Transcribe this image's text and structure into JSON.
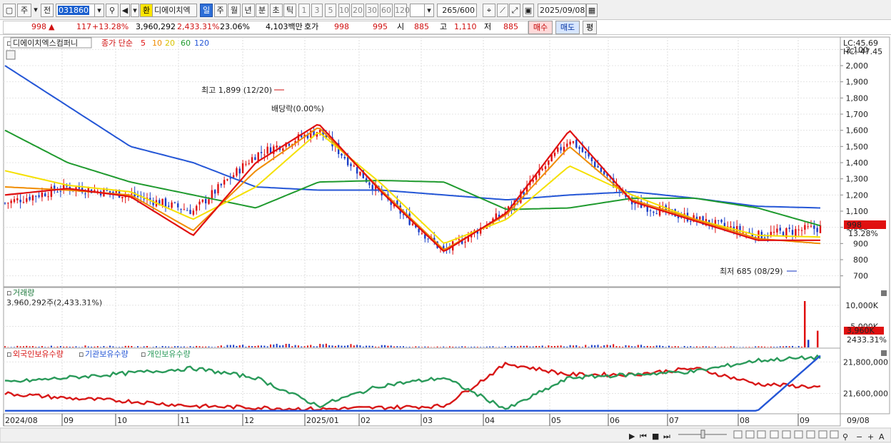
{
  "toolbar": {
    "market_label": "주",
    "prev_label": "전",
    "stock_code": "031860",
    "fx_label": "환",
    "stock_name": "디에이치엑",
    "period_tabs": [
      "일",
      "주",
      "월",
      "년",
      "분",
      "초",
      "틱"
    ],
    "active_period": "일",
    "interval_options": [
      "1",
      "3",
      "5",
      "10",
      "20",
      "30",
      "60",
      "120"
    ],
    "count": "265",
    "count_total": "/600",
    "date": "2025/09/08"
  },
  "quote": {
    "price": "998",
    "change_arrow": "▲",
    "change": "117",
    "change_pct": "+13.28%",
    "volume": "3,960,292",
    "volume_ratio": "2,433.31%",
    "turnover": "23.06%",
    "amount": "4,103백만",
    "ask_label": "호가",
    "ask1": "998",
    "bid1": "995",
    "open_label": "시",
    "open": "885",
    "high_label": "고",
    "high": "1,110",
    "low_label": "저",
    "low": "885",
    "buy_label": "매수",
    "sell_label": "매도",
    "eval_label": "평"
  },
  "price_panel": {
    "stock_name": "디에이치엑스컴퍼니",
    "ma_label": "종가 단순",
    "ma_periods": [
      "5",
      "10",
      "20",
      "60",
      "120"
    ],
    "ma_colors": [
      "#e01010",
      "#f08c00",
      "#f5e000",
      "#1f9a2e",
      "#2456d6"
    ],
    "lc_label": "LC:45.69",
    "hc_label": "HC:-47.45",
    "y_ticks": [
      "2,100",
      "2,000",
      "1,900",
      "1,800",
      "1,700",
      "1,600",
      "1,500",
      "1,400",
      "1,300",
      "1,200",
      "1,100",
      "1,000",
      "900",
      "800",
      "700"
    ],
    "high_annotation": "최고 1,899 (12/20)",
    "low_annotation": "최저 685 (08/29)",
    "dividend_annotation": "배당락(0.00%)",
    "current_price": "998",
    "current_change": "13.28%"
  },
  "volume_panel": {
    "title": "거래량",
    "summary": "3,960,292주(2,433.31%)",
    "y_ticks": [
      "10,000K",
      "5,000K"
    ],
    "current_volume": "3,960K",
    "current_ratio": "2433.31%"
  },
  "holdings_panel": {
    "legend": [
      {
        "name": "외국인보유수량",
        "color": "#d81818"
      },
      {
        "name": "기관보유수량",
        "color": "#2456d6"
      },
      {
        "name": "개인보유수량",
        "color": "#2a9a5a"
      }
    ],
    "y_ticks": [
      "21,800,000",
      "21,600,000"
    ]
  },
  "x_axis": {
    "labels": [
      "2024/08",
      "09",
      "10",
      "11",
      "12",
      "2025/01",
      "02",
      "03",
      "04",
      "05",
      "06",
      "07",
      "08",
      "09"
    ],
    "right_label": "09/08"
  },
  "chart_data": {
    "type": "line",
    "title": "디에이치엑스컴퍼니",
    "x": [
      "2024/08",
      "09",
      "10",
      "11",
      "12",
      "2025/01",
      "02",
      "03",
      "04",
      "05",
      "06",
      "07",
      "08",
      "09"
    ],
    "ylim": [
      650,
      2150
    ],
    "series": [
      {
        "name": "종가",
        "values": [
          1150,
          1250,
          1200,
          1100,
          1450,
          1600,
          1200,
          850,
          1100,
          1550,
          1150,
          1050,
          950,
          998
        ]
      },
      {
        "name": "120",
        "values": [
          2000,
          1750,
          1500,
          1400,
          1250,
          1230,
          1230,
          1200,
          1170,
          1200,
          1220,
          1180,
          1130,
          1120
        ]
      },
      {
        "name": "60",
        "values": [
          1600,
          1400,
          1280,
          1200,
          1120,
          1280,
          1290,
          1280,
          1110,
          1120,
          1180,
          1180,
          1120,
          1010
        ]
      },
      {
        "name": "20",
        "values": [
          1350,
          1260,
          1220,
          1050,
          1250,
          1590,
          1270,
          900,
          1050,
          1380,
          1200,
          1050,
          950,
          940
        ]
      },
      {
        "name": "10",
        "values": [
          1250,
          1230,
          1200,
          980,
          1350,
          1620,
          1230,
          860,
          1080,
          1500,
          1170,
          1050,
          930,
          900
        ]
      },
      {
        "name": "5",
        "values": [
          1200,
          1240,
          1190,
          950,
          1400,
          1640,
          1220,
          850,
          1090,
          1600,
          1160,
          1040,
          920,
          920
        ]
      }
    ],
    "volume": {
      "ylim": [
        0,
        11000
      ],
      "values_k": [
        200,
        300,
        200,
        250,
        600,
        500,
        200,
        150,
        300,
        500,
        200,
        150,
        300,
        11000,
        3960
      ]
    },
    "holdings": {
      "ylim": [
        21480000,
        21870000
      ],
      "foreign": [
        21600000,
        21570000,
        21550000,
        21520000,
        21510000,
        21500000,
        21510000,
        21520000,
        21790000,
        21720000,
        21720000,
        21760000,
        21660000,
        21640000
      ],
      "institution": [
        21490000,
        21490000,
        21490000,
        21490000,
        21490000,
        21490000,
        21490000,
        21490000,
        21490000,
        21490000,
        21490000,
        21490000,
        21490000,
        21840000
      ],
      "individual": [
        21670000,
        21700000,
        21730000,
        21760000,
        21700000,
        21520000,
        21650000,
        21700000,
        21500000,
        21700000,
        21720000,
        21740000,
        21810000,
        21830000
      ]
    }
  }
}
